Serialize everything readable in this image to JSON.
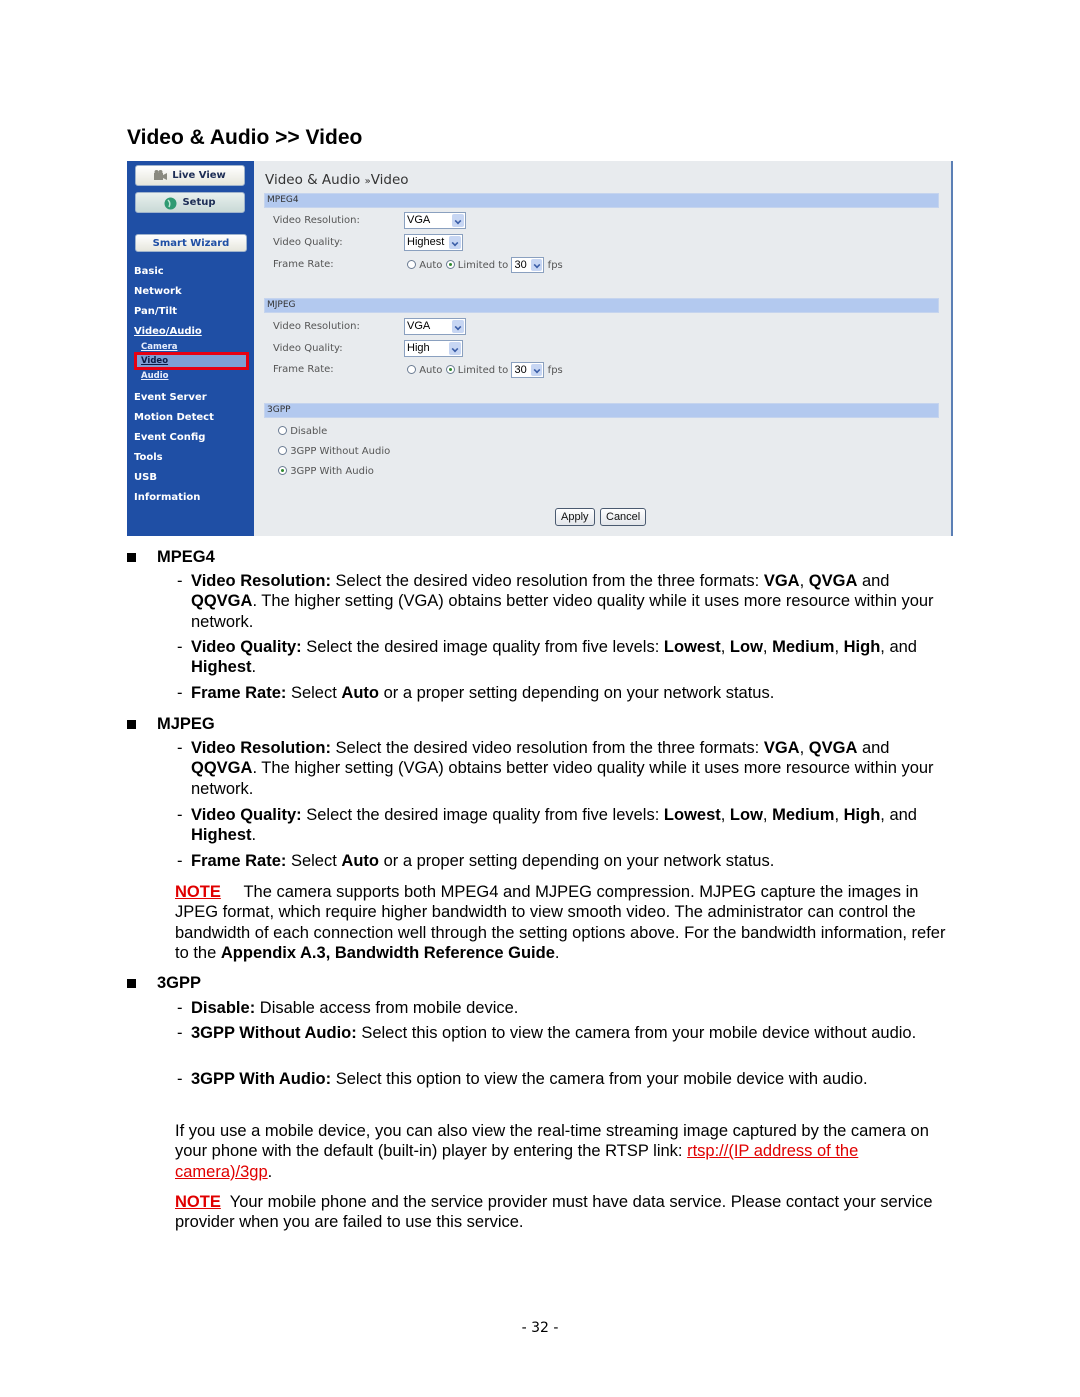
{
  "heading": "Video & Audio >> Video",
  "screenshot": {
    "sidebar": {
      "live_view": "Live View",
      "setup": "Setup",
      "smart_wizard": "Smart Wizard",
      "items": [
        "Basic",
        "Network",
        "Pan/Tilt",
        "Video/Audio"
      ],
      "sub_items": [
        "Camera",
        "Video",
        "Audio"
      ],
      "active_sub": "Video",
      "items2": [
        "Event Server",
        "Motion Detect",
        "Event Config",
        "Tools",
        "USB",
        "Information"
      ]
    },
    "title_part1": "Video & Audio",
    "title_sep": "»",
    "title_part2": "Video",
    "mpeg4": {
      "header": "MPEG4",
      "res_label": "Video Resolution:",
      "res_value": "VGA",
      "quality_label": "Video Quality:",
      "quality_value": "Highest",
      "fr_label": "Frame Rate:",
      "auto": "Auto",
      "limited": "Limited to",
      "fps_value": "30",
      "fps_unit": "fps",
      "selected": "Limited to"
    },
    "mjpeg": {
      "header": "MJPEG",
      "res_label": "Video Resolution:",
      "res_value": "VGA",
      "quality_label": "Video Quality:",
      "quality_value": "High",
      "fr_label": "Frame Rate:",
      "auto": "Auto",
      "limited": "Limited to",
      "fps_value": "30",
      "fps_unit": "fps",
      "selected": "Limited to"
    },
    "gpp": {
      "header": "3GPP",
      "options": [
        "Disable",
        "3GPP Without Audio",
        "3GPP With Audio"
      ],
      "selected": "3GPP With Audio"
    },
    "apply": "Apply",
    "cancel": "Cancel"
  },
  "doc": {
    "mpeg4": {
      "title": "MPEG4",
      "res": {
        "b": "Video Resolution:",
        "t1": " Select the desired video resolution from the three formats: ",
        "b1": "VGA",
        "t2": ", ",
        "b2": "QVGA",
        "t3": " and ",
        "b3": "QQVGA",
        "t4": ". The higher setting (VGA) obtains better video quality while it uses more resource within your network."
      },
      "qual": {
        "b": "Video Quality:",
        "t1": " Select the desired image quality from five levels: ",
        "b1": "Lowest",
        "t2": ", ",
        "b2": "Low",
        "t3": ", ",
        "b3": "Medium",
        "t4": ", ",
        "b4": "High",
        "t5": ", and ",
        "b5": "Highest",
        "t6": "."
      },
      "fr": {
        "b": "Frame Rate:",
        "t1": " Select ",
        "b1": "Auto",
        "t2": " or a proper setting depending on your network status."
      }
    },
    "mjpeg": {
      "title": "MJPEG",
      "res": {
        "b": "Video Resolution:",
        "t1": " Select the desired video resolution from the three formats: ",
        "b1": "VGA",
        "t2": ", ",
        "b2": "QVGA",
        "t3": " and ",
        "b3": "QQVGA",
        "t4": ". The higher setting (VGA) obtains better video quality while it uses more resource within your network."
      },
      "qual": {
        "b": "Video Quality:",
        "t1": " Select the desired image quality from five levels: ",
        "b1": "Lowest",
        "t2": ", ",
        "b2": "Low",
        "t3": ", ",
        "b3": "Medium",
        "t4": ", ",
        "b4": "High",
        "t5": ", and ",
        "b5": "Highest",
        "t6": "."
      },
      "fr": {
        "b": "Frame Rate:",
        "t1": " Select ",
        "b1": "Auto",
        "t2": " or a proper setting depending on your network status."
      }
    },
    "note1": {
      "label": "NOTE",
      "t1": "     The camera supports both MPEG4 and MJPEG compression. MJPEG capture the images in JPEG format, which require higher bandwidth to view smooth video. The administrator can control the bandwidth of each connection well through the setting options above. For the bandwidth information, refer to the ",
      "b1": "Appendix A.3, Bandwidth Reference Guide",
      "t2": "."
    },
    "gpp": {
      "title": "3GPP",
      "disable": {
        "b": "Disable:",
        "t": " Disable access from mobile device."
      },
      "without": {
        "b": "3GPP Without Audio:",
        "t": " Select this option to view the camera from your mobile device without audio."
      },
      "with": {
        "b": "3GPP With Audio:",
        "t": " Select this option to view the camera from your mobile device with audio."
      }
    },
    "mobile": {
      "t1": "If you use a mobile device, you can also view the real-time streaming image captured by the camera on your phone with the default (built-in) player by entering the RTSP link: ",
      "link": "rtsp://(IP address of the camera)/3gp",
      "t2": "."
    },
    "note2": {
      "label": "NOTE",
      "t1": "  Your mobile phone and the service provider must have data service. Please contact your service provider when you are failed to use this service."
    },
    "dash": "-",
    "page_number": "- 32 -"
  },
  "colors": {
    "sidebar": "#1f4fa5",
    "section_bar": "#b3c9ef",
    "note": "#e00000",
    "highlight": "#e60012"
  }
}
